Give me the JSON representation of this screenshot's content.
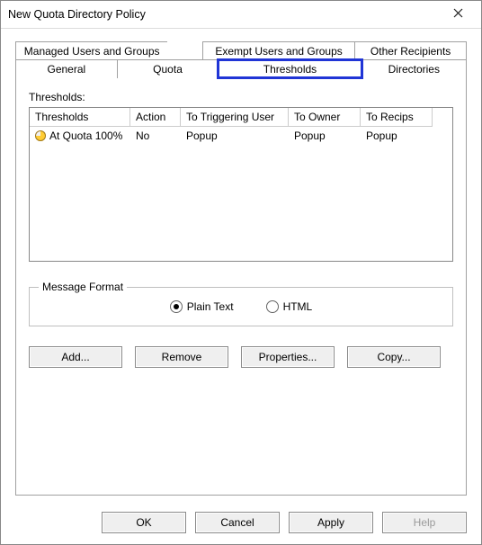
{
  "window": {
    "title": "New Quota Directory Policy"
  },
  "tabs": {
    "row1": [
      {
        "label": "Managed Users and Groups"
      },
      {
        "label": "Exempt Users and Groups"
      },
      {
        "label": "Other Recipients"
      }
    ],
    "row2": [
      {
        "label": "General"
      },
      {
        "label": "Quota"
      },
      {
        "label": "Thresholds",
        "selected": true
      },
      {
        "label": "Directories"
      }
    ]
  },
  "thresholds": {
    "section_label": "Thresholds:",
    "columns": [
      "Thresholds",
      "Action",
      "To Triggering User",
      "To Owner",
      "To Recips"
    ],
    "rows": [
      {
        "name": "At Quota 100%",
        "action": "No",
        "to_trigger": "Popup",
        "to_owner": "Popup",
        "to_recips": "Popup"
      }
    ]
  },
  "message_format": {
    "legend": "Message Format",
    "plain_text": "Plain Text",
    "html": "HTML",
    "selected": "plain_text"
  },
  "buttons": {
    "add": "Add...",
    "remove": "Remove",
    "properties": "Properties...",
    "copy": "Copy..."
  },
  "footer": {
    "ok": "OK",
    "cancel": "Cancel",
    "apply": "Apply",
    "help": "Help"
  }
}
